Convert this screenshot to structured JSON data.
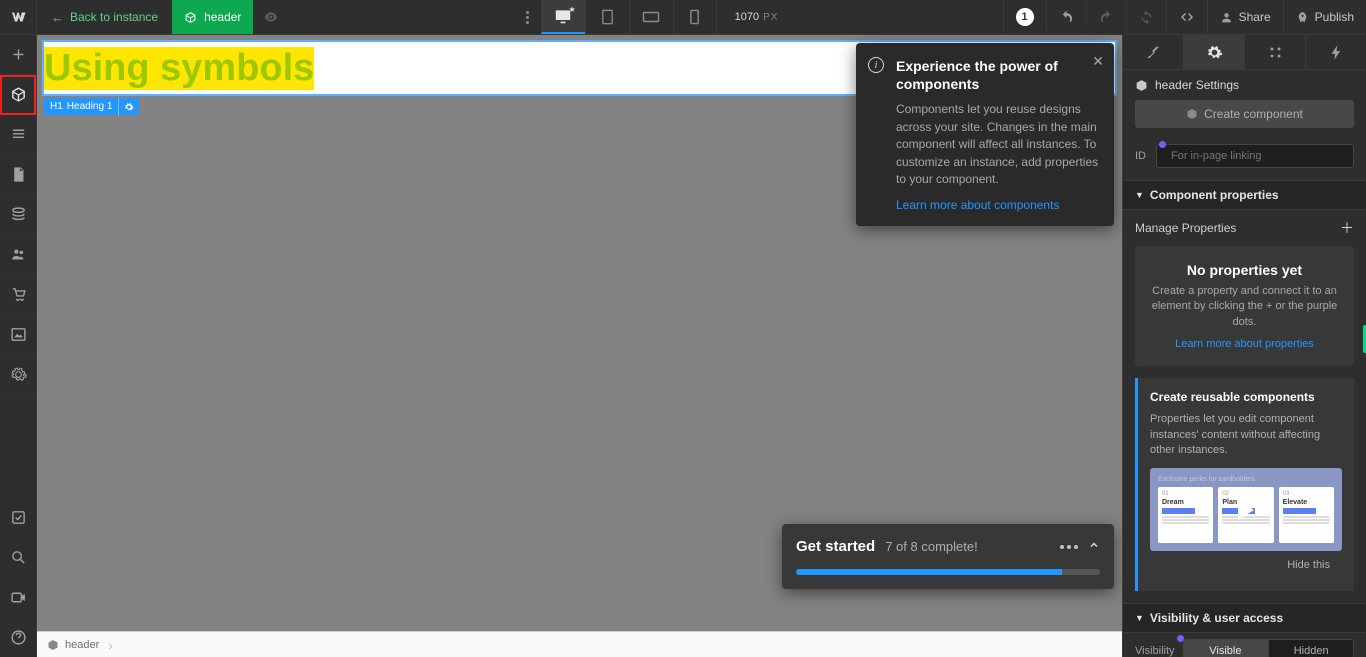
{
  "top": {
    "back_label": "Back to instance",
    "tab_label": "header",
    "dim_value": "1070",
    "dim_unit": "PX",
    "badge": "1",
    "share": "Share",
    "publish": "Publish"
  },
  "canvas": {
    "heading_text": "Using symbols",
    "selector_h1": "H1",
    "selector_label": "Heading 1",
    "breadcrumb_item": "header"
  },
  "tooltip": {
    "title": "Experience the power of components",
    "body": "Components let you reuse designs across your site. Changes in the main component will affect all instances. To customize an instance, add properties to your component.",
    "link": "Learn more about components"
  },
  "get_started": {
    "title": "Get started",
    "subtitle": "7 of 8 complete!",
    "progress_current": 7,
    "progress_total": 8
  },
  "right": {
    "settings_label": "header Settings",
    "create_component_btn": "Create component",
    "id_label": "ID",
    "id_placeholder": "For in-page linking",
    "section_cp": "Component properties",
    "manage_label": "Manage Properties",
    "noprop_title": "No properties yet",
    "noprop_body": "Create a property and connect it to an element by clicking the + or the purple dots.",
    "noprop_link": "Learn more about properties",
    "create_title": "Create reusable components",
    "create_body": "Properties let you edit component instances' content without affecting other instances.",
    "thumb_label": "Exclusive perks for cardholders",
    "thumb_c1_k": "01",
    "thumb_c1_t": "Dream",
    "thumb_c2_k": "02",
    "thumb_c2_t": "Plan",
    "thumb_c3_k": "03",
    "thumb_c3_t": "Elevate",
    "hide_this": "Hide this",
    "section_vis": "Visibility & user access",
    "vis_label": "Visibility",
    "vis_visible": "Visible",
    "vis_hidden": "Hidden"
  }
}
